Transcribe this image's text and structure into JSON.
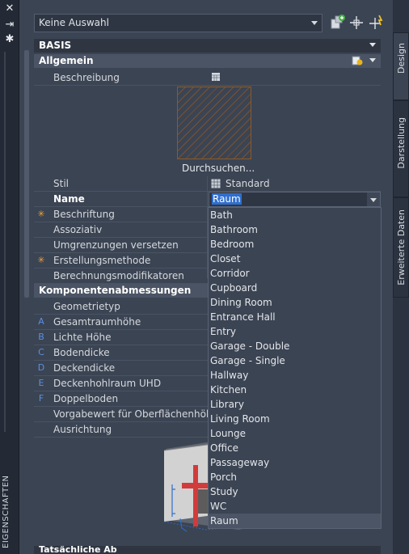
{
  "window": {
    "vertical_title": "EIGENSCHAFTEN",
    "close_glyph": "✕",
    "pin_glyph": "⇥",
    "options_glyph": "✱"
  },
  "toolbar": {
    "selection": "Keine Auswahl"
  },
  "sections": {
    "basis": "BASIS",
    "allgemein": "Allgemein",
    "komponenten": "Komponentenabmessungen",
    "bottom_clipped": "Tatsächliche Ab"
  },
  "general": {
    "beschreibung": "Beschreibung",
    "browse": "Durchsuchen...",
    "stil_label": "Stil",
    "stil_value": "Standard",
    "name_label": "Name",
    "name_value": "Raum",
    "rows": [
      {
        "label": "Beschriftung",
        "marker": "✳"
      },
      {
        "label": "Assoziativ",
        "marker": ""
      },
      {
        "label": "Umgrenzungen versetzen",
        "marker": ""
      },
      {
        "label": "Erstellungsmethode",
        "marker": "✳"
      },
      {
        "label": "Berechnungsmodifikatoren",
        "marker": ""
      }
    ]
  },
  "dimensions": {
    "rows": [
      {
        "label": "Geometrietyp",
        "marker": ""
      },
      {
        "label": "Gesamtraumhöhe",
        "marker": "A"
      },
      {
        "label": "Lichte Höhe",
        "marker": "B"
      },
      {
        "label": "Bodendicke",
        "marker": "C"
      },
      {
        "label": "Deckendicke",
        "marker": "D"
      },
      {
        "label": "Deckenhohlraum UHD",
        "marker": "E"
      },
      {
        "label": "Doppelboden",
        "marker": "F"
      },
      {
        "label": "Vorgabewert für Oberflächenhöhe",
        "marker": ""
      },
      {
        "label": "Ausrichtung",
        "marker": ""
      }
    ]
  },
  "name_options": [
    "Bath",
    "Bathroom",
    "Bedroom",
    "Closet",
    "Corridor",
    "Cupboard",
    "Dining Room",
    "Entrance Hall",
    "Entry",
    "Garage - Double",
    "Garage - Single",
    "Hallway",
    "Kitchen",
    "Library",
    "Living Room",
    "Lounge",
    "Office",
    "Passageway",
    "Porch",
    "Study",
    "WC",
    "Raum"
  ],
  "name_selected": "Raum",
  "side_tabs": {
    "design": "Design",
    "darstellung": "Darstellung",
    "erweitert": "Erweiterte Daten"
  },
  "colors": {
    "accent_selection": "#2f6fcf",
    "marker_letter": "#5b8fe0",
    "marker_star": "#e8a040",
    "panel_bg": "#3b4453"
  }
}
